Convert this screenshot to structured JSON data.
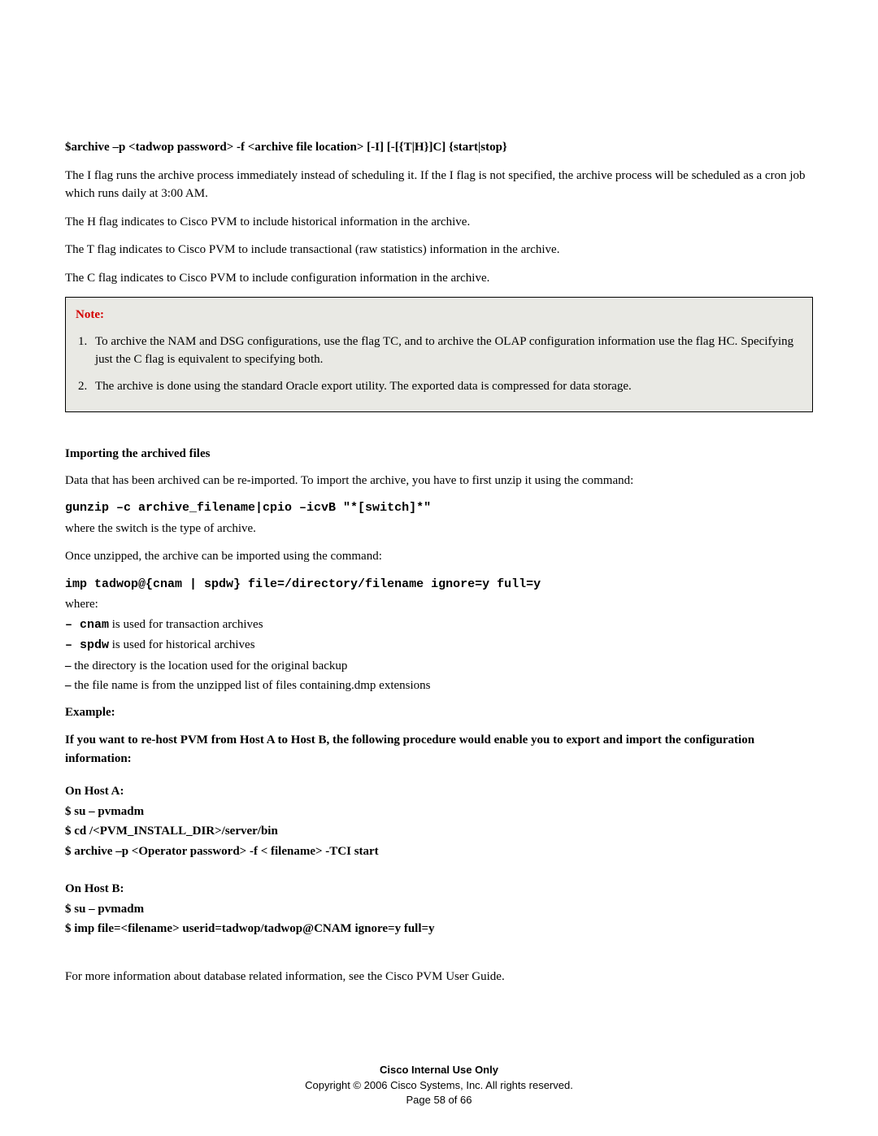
{
  "cmd_syntax": "$archive –p <tadwop password> -f <archive file location> [-I] [-[{T|H}]C] {start|stop}",
  "p_iflag": "The I flag runs the archive process immediately instead of scheduling it. If the I flag is not specified, the archive process will be scheduled as a cron job which runs daily at 3:00 AM.",
  "p_hflag": "The H flag indicates to Cisco PVM to include historical information in the archive.",
  "p_tflag": "The T flag indicates to Cisco PVM to include transactional (raw statistics) information in the archive.",
  "p_cflag": "The C flag indicates to Cisco PVM to include configuration information in the archive.",
  "note_label": "Note:",
  "note_items": [
    "To archive the NAM and DSG configurations, use the flag TC, and to archive the OLAP configuration information use the flag HC. Specifying just the C flag is equivalent to specifying both.",
    "The archive is done using the standard Oracle export utility. The exported data is compressed for data storage."
  ],
  "sec_import_title": "Importing the archived files",
  "p_import_intro": "Data that has been archived can be re-imported. To import the archive, you have to first unzip it using the command:",
  "cmd_gunzip": "gunzip –c archive_filename|cpio –icvB \"*[switch]*\"",
  "p_where_switch": "where the switch is the type of archive.",
  "p_once_unzipped": "Once unzipped, the archive can be imported using the command:",
  "cmd_imp": "imp tadwop@{cnam | spdw} file=/directory/filename ignore=y full=y",
  "p_where": "where:",
  "bullets": {
    "b1_code": "– cnam",
    "b1_rest": "  is used for transaction archives",
    "b2_code": "– spdw",
    "b2_rest": "  is used for historical archives",
    "b3": "– the directory is the location used for the original backup",
    "b4": "– the file name is from the unzipped list of files containing.dmp extensions"
  },
  "example_label": "Example:",
  "example_intro": "If you want to re-host PVM from Host A to Host B, the following procedure would enable you to export and import the configuration information:",
  "hostA": {
    "title": "On Host A:",
    "l1": "$ su – pvmadm",
    "l2": "$ cd /<PVM_INSTALL_DIR>/server/bin",
    "l3": "$ archive –p <Operator password> -f < filename> -TCI start"
  },
  "hostB": {
    "title": "On Host B:",
    "l1": "$ su – pvmadm",
    "l2": "$ imp file=<filename> userid=tadwop/tadwop@CNAM ignore=y  full=y"
  },
  "p_more_info": "For more information about database related information, see the Cisco PVM User Guide.",
  "footer": {
    "line1": "Cisco Internal Use Only",
    "line2": "Copyright © 2006 Cisco Systems, Inc. All rights reserved.",
    "line3": "Page 58 of 66"
  }
}
